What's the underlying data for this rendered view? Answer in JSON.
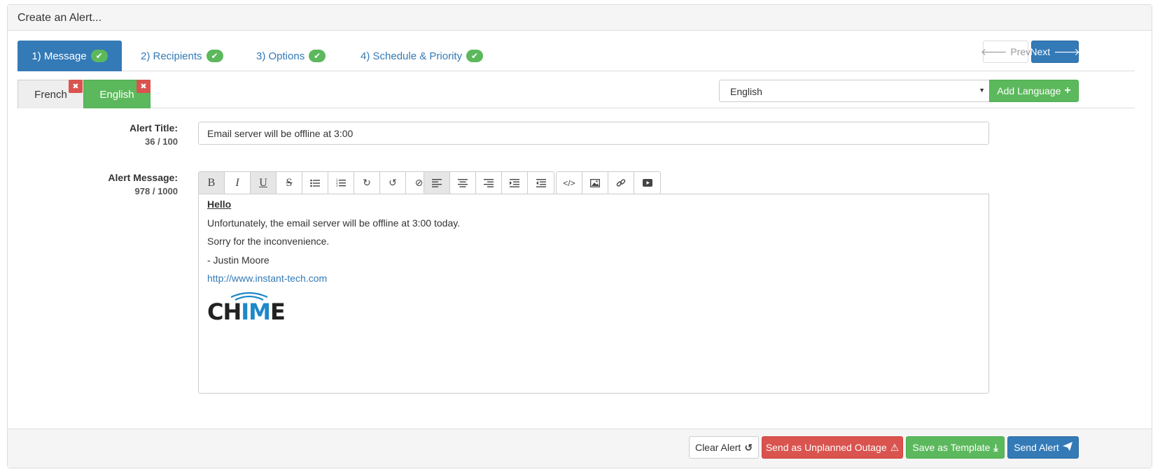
{
  "panel": {
    "title": "Create an Alert..."
  },
  "wizard": {
    "tabs": [
      {
        "label": "1) Message",
        "active": true
      },
      {
        "label": "2) Recipients",
        "active": false
      },
      {
        "label": "3) Options",
        "active": false
      },
      {
        "label": "4) Schedule & Priority",
        "active": false
      }
    ],
    "prev_label": "Prev",
    "next_label": "Next",
    "check_icon": "check-icon"
  },
  "languages": {
    "tabs": [
      {
        "label": "French",
        "active": false
      },
      {
        "label": "English",
        "active": true
      }
    ],
    "remove_icon": "close-icon",
    "select_value": "English",
    "add_label": "Add Language"
  },
  "form": {
    "title_label": "Alert Title:",
    "title_counter": "36 / 100",
    "title_value": "Email server will be offline at 3:00",
    "message_label": "Alert Message:",
    "message_counter": "978 / 1000"
  },
  "toolbar": {
    "groups": [
      [
        "bold-icon",
        "italic-icon",
        "underline-icon",
        "strikethrough-icon",
        "unordered-list-icon",
        "ordered-list-icon",
        "redo-icon",
        "undo-icon",
        "clear-format-icon"
      ],
      [
        "align-left-icon",
        "align-center-icon",
        "align-right-icon",
        "indent-icon",
        "outdent-icon"
      ],
      [
        "code-icon",
        "image-icon",
        "link-icon",
        "video-icon"
      ]
    ]
  },
  "editor": {
    "heading": "Hello",
    "line1": "Unfortunately, the email server will be offline at 3:00 today.",
    "line2": "Sorry for the inconvenience.",
    "signature": "- Justin Moore",
    "link": "http://www.instant-tech.com",
    "logo_text_1": "CH",
    "logo_text_2": "IM",
    "logo_text_3": "E",
    "logo_colors": {
      "dark": "#222222",
      "blue": "#1e88c8"
    }
  },
  "footer": {
    "clear_label": "Clear Alert",
    "outage_label": "Send as Unplanned Outage",
    "template_label": "Save as Template",
    "send_label": "Send Alert"
  },
  "colors": {
    "primary": "#337ab7",
    "success": "#5cb85c",
    "danger": "#d9534f"
  }
}
